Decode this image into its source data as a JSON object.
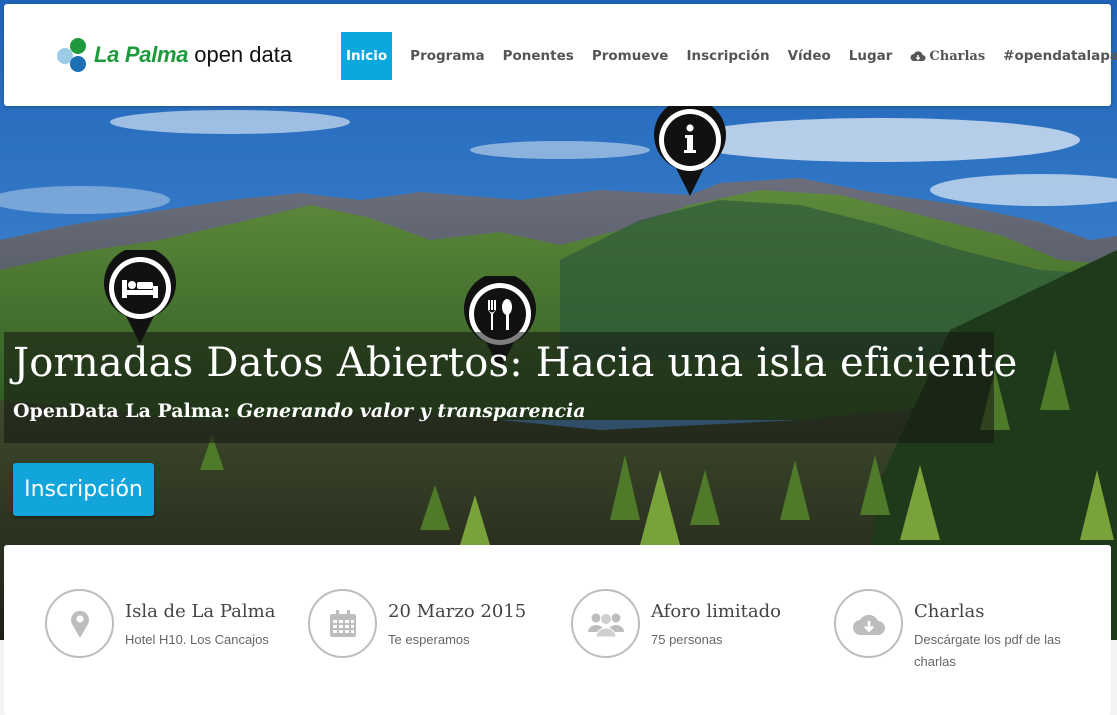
{
  "brand": {
    "name_a": "La Palma",
    "name_b": "open data"
  },
  "nav": {
    "items": [
      {
        "label": "Inicio",
        "active": true
      },
      {
        "label": "Programa"
      },
      {
        "label": "Ponentes"
      },
      {
        "label": "Promueve"
      },
      {
        "label": "Inscripción"
      },
      {
        "label": "Vídeo"
      },
      {
        "label": "Lugar"
      },
      {
        "label": "Charlas",
        "icon": "cloud-download-icon"
      },
      {
        "label": "#opendatalapalma"
      }
    ]
  },
  "hero": {
    "title": "Jornadas Datos Abiertos: Hacia una isla eficiente",
    "subtitle_plain": "OpenData La Palma: ",
    "subtitle_em": "Generando valor y transparencia",
    "cta_label": "Inscripción",
    "pins": [
      "info-icon",
      "bed-icon",
      "fork-knife-icon"
    ]
  },
  "features": [
    {
      "icon": "map-marker-icon",
      "title": "Isla de La Palma",
      "desc": "Hotel H10. Los Cancajos"
    },
    {
      "icon": "calendar-icon",
      "title": "20 Marzo 2015",
      "desc": "Te esperamos"
    },
    {
      "icon": "users-icon",
      "title": "Aforo limitado",
      "desc": "75 personas"
    },
    {
      "icon": "cloud-download-icon",
      "title": "Charlas",
      "desc": "Descárgate los pdf de las charlas"
    }
  ],
  "colors": {
    "accent": "#0ba8dd",
    "brand_green": "#1e9a3c",
    "brand_blue": "#1b6fb5"
  }
}
